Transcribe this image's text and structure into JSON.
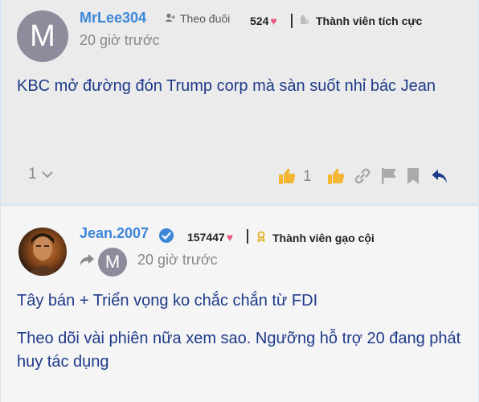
{
  "post1": {
    "avatar_letter": "M",
    "username": "MrLee304",
    "follow_label": "Theo đuôi",
    "likes_count": "524",
    "rank_label": "Thành viên tích cực",
    "time": "20 giờ trước",
    "body": "KBC mở đường đón Trump corp mà sàn suốt nhỉ bác Jean",
    "replies_count": "1",
    "like_count": "1"
  },
  "post2": {
    "username": "Jean.2007",
    "likes_count": "157447",
    "rank_label": "Thành viên gạo cội",
    "reply_to_avatar_letter": "M",
    "time": "20 giờ trước",
    "body_lines": [
      "Tây bán + Triển vọng ko chắc chắn từ FDI",
      "Theo dõi vài phiên nữa xem sao. Ngưỡng hỗ trợ 20 đang phát huy tác dụng"
    ]
  },
  "colors": {
    "username": "#3d86d8",
    "body_text": "#1e3a8a",
    "heart": "#e8577e",
    "like_yellow": "#f2b632",
    "reply_blue": "#1e3a8a",
    "rank_gold": "#e0b020"
  },
  "icons": [
    "follow-icon",
    "heart-icon",
    "rank-icon",
    "chevron-down-icon",
    "thumbs-up-icon",
    "link-icon",
    "flag-icon",
    "bookmark-icon",
    "reply-icon",
    "verified-icon",
    "share-arrow-icon"
  ]
}
